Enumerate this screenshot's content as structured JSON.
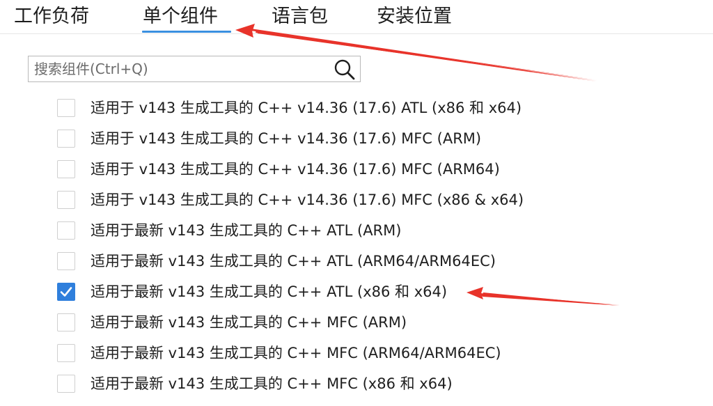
{
  "tabs": [
    {
      "label": "工作负荷"
    },
    {
      "label": "单个组件"
    },
    {
      "label": "语言包"
    },
    {
      "label": "安装位置"
    }
  ],
  "search": {
    "placeholder": "搜索组件(Ctrl+Q)",
    "value": ""
  },
  "components": [
    {
      "label": "适用于 v143 生成工具的 C++ v14.36 (17.6) ATL (x86 和 x64)",
      "checked": false
    },
    {
      "label": "适用于 v143 生成工具的 C++ v14.36 (17.6) MFC (ARM)",
      "checked": false
    },
    {
      "label": "适用于 v143 生成工具的 C++ v14.36 (17.6) MFC (ARM64)",
      "checked": false
    },
    {
      "label": "适用于 v143 生成工具的 C++ v14.36 (17.6) MFC (x86 & x64)",
      "checked": false
    },
    {
      "label": "适用于最新 v143 生成工具的 C++ ATL (ARM)",
      "checked": false
    },
    {
      "label": "适用于最新 v143 生成工具的 C++ ATL (ARM64/ARM64EC)",
      "checked": false
    },
    {
      "label": "适用于最新 v143 生成工具的 C++ ATL (x86 和 x64)",
      "checked": true
    },
    {
      "label": "适用于最新 v143 生成工具的 C++ MFC (ARM)",
      "checked": false
    },
    {
      "label": "适用于最新 v143 生成工具的 C++ MFC (ARM64/ARM64EC)",
      "checked": false
    },
    {
      "label": "适用于最新 v143 生成工具的 C++ MFC (x86 和 x64)",
      "checked": false
    }
  ],
  "annotation_color": "#e8332a",
  "accent_color": "#2f7fdc",
  "icons": {
    "search": "magnifier-icon",
    "check": "checkmark-icon"
  }
}
